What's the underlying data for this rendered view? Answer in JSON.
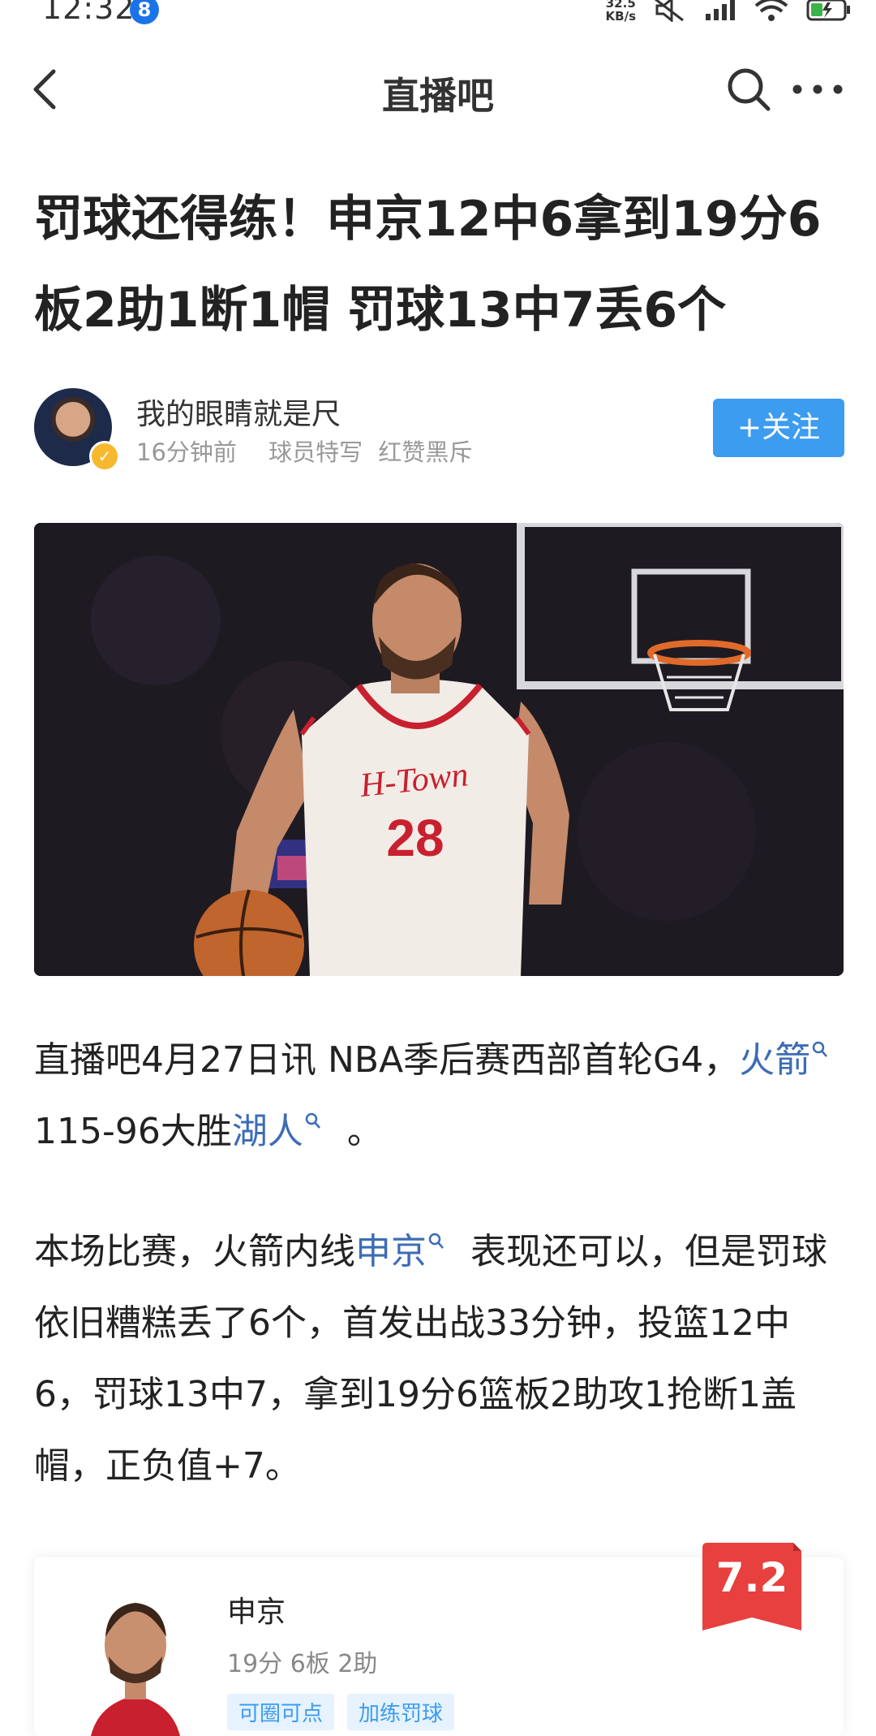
{
  "status_bar": {
    "time": "12:32",
    "badge": "8",
    "net_speed_value": "32.5",
    "net_speed_unit": "KB/s"
  },
  "nav": {
    "title": "直播吧",
    "icons": [
      "back-arrow-icon",
      "search-icon",
      "more-icon"
    ]
  },
  "article": {
    "headline": "罚球还得练！申京12中6拿到19分6板2助1断1帽 罚球13中7丢6个",
    "author": {
      "name": "我的眼睛就是尺",
      "time": "16分钟前",
      "tag1": "球员特写",
      "tag2": "红赞黑斥",
      "follow_label": "+关注"
    },
    "para1": {
      "text_a": "直播吧4月27日讯 NBA季后赛西部首轮G4，",
      "link1": "火箭",
      "text_b": " 115-96大胜",
      "link2": "湖人",
      "text_c": " 。"
    },
    "para2": {
      "text_a": "本场比赛，火箭内线",
      "link1": "申京",
      "text_b": " 表现还可以，但是罚球依旧糟糕丢了6个，首发出战33分钟，投篮12中6，罚球13中7，拿到19分6篮板2助攻1抢断1盖帽，正负值+7。"
    }
  },
  "player_card": {
    "name": "申京",
    "stats": "19分 6板 2助",
    "tags": [
      "可圈可点",
      "加练罚球"
    ],
    "rating": "7.2"
  },
  "image": {
    "jersey_text": "H-Town",
    "jersey_number": "28"
  },
  "colors": {
    "link": "#3d6cb5",
    "follow_bg": "#3c9cf0",
    "rating_bg": "#e8403f"
  }
}
